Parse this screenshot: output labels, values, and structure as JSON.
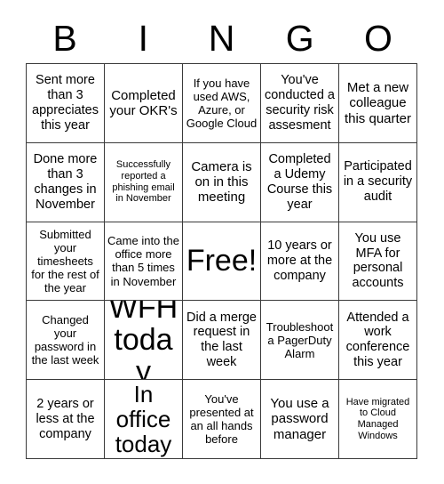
{
  "card": {
    "title": "BINGO",
    "header_letters": [
      "B",
      "I",
      "N",
      "G",
      "O"
    ],
    "border_color": "#3a3a3a",
    "background_color": "#ffffff",
    "text_color": "#000000",
    "columns": 5,
    "rows": 5,
    "free_space_index": 12,
    "cells": [
      {
        "text": "Sent more than 3 appreciates this year",
        "size": "md"
      },
      {
        "text": "Completed your OKR's",
        "size": "lg"
      },
      {
        "text": "If you have used AWS, Azure, or Google Cloud",
        "size": "sm"
      },
      {
        "text": "You've conducted a security risk assesment",
        "size": "md"
      },
      {
        "text": "Met a new colleague this quarter",
        "size": "lg"
      },
      {
        "text": "Done more than 3 changes in November",
        "size": "md"
      },
      {
        "text": "Successfully reported a phishing email in November",
        "size": "xs"
      },
      {
        "text": "Camera is on in this meeting",
        "size": "lg"
      },
      {
        "text": "Completed a Udemy Course this year",
        "size": "md"
      },
      {
        "text": "Participated in a security audit",
        "size": "md"
      },
      {
        "text": "Submitted your timesheets for the rest of the year",
        "size": "sm"
      },
      {
        "text": "Came into the office more than 5 times in November",
        "size": "sm"
      },
      {
        "text": "Free!",
        "size": "free"
      },
      {
        "text": "10 years or more at the company",
        "size": "md"
      },
      {
        "text": "You use MFA for personal accounts",
        "size": "md"
      },
      {
        "text": "Changed your password in the last week",
        "size": "sm"
      },
      {
        "text": "WFH today",
        "size": "xxl"
      },
      {
        "text": "Did a merge request in the last week",
        "size": "md"
      },
      {
        "text": "Troubleshoot a PagerDuty Alarm",
        "size": "sm"
      },
      {
        "text": "Attended a work conference this year",
        "size": "md"
      },
      {
        "text": "2 years or less at the company",
        "size": "md"
      },
      {
        "text": "In office today",
        "size": "xl"
      },
      {
        "text": "You've presented at an all hands before",
        "size": "sm"
      },
      {
        "text": "You use a password manager",
        "size": "lg"
      },
      {
        "text": "Have migrated to Cloud Managed Windows",
        "size": "xs"
      }
    ]
  }
}
